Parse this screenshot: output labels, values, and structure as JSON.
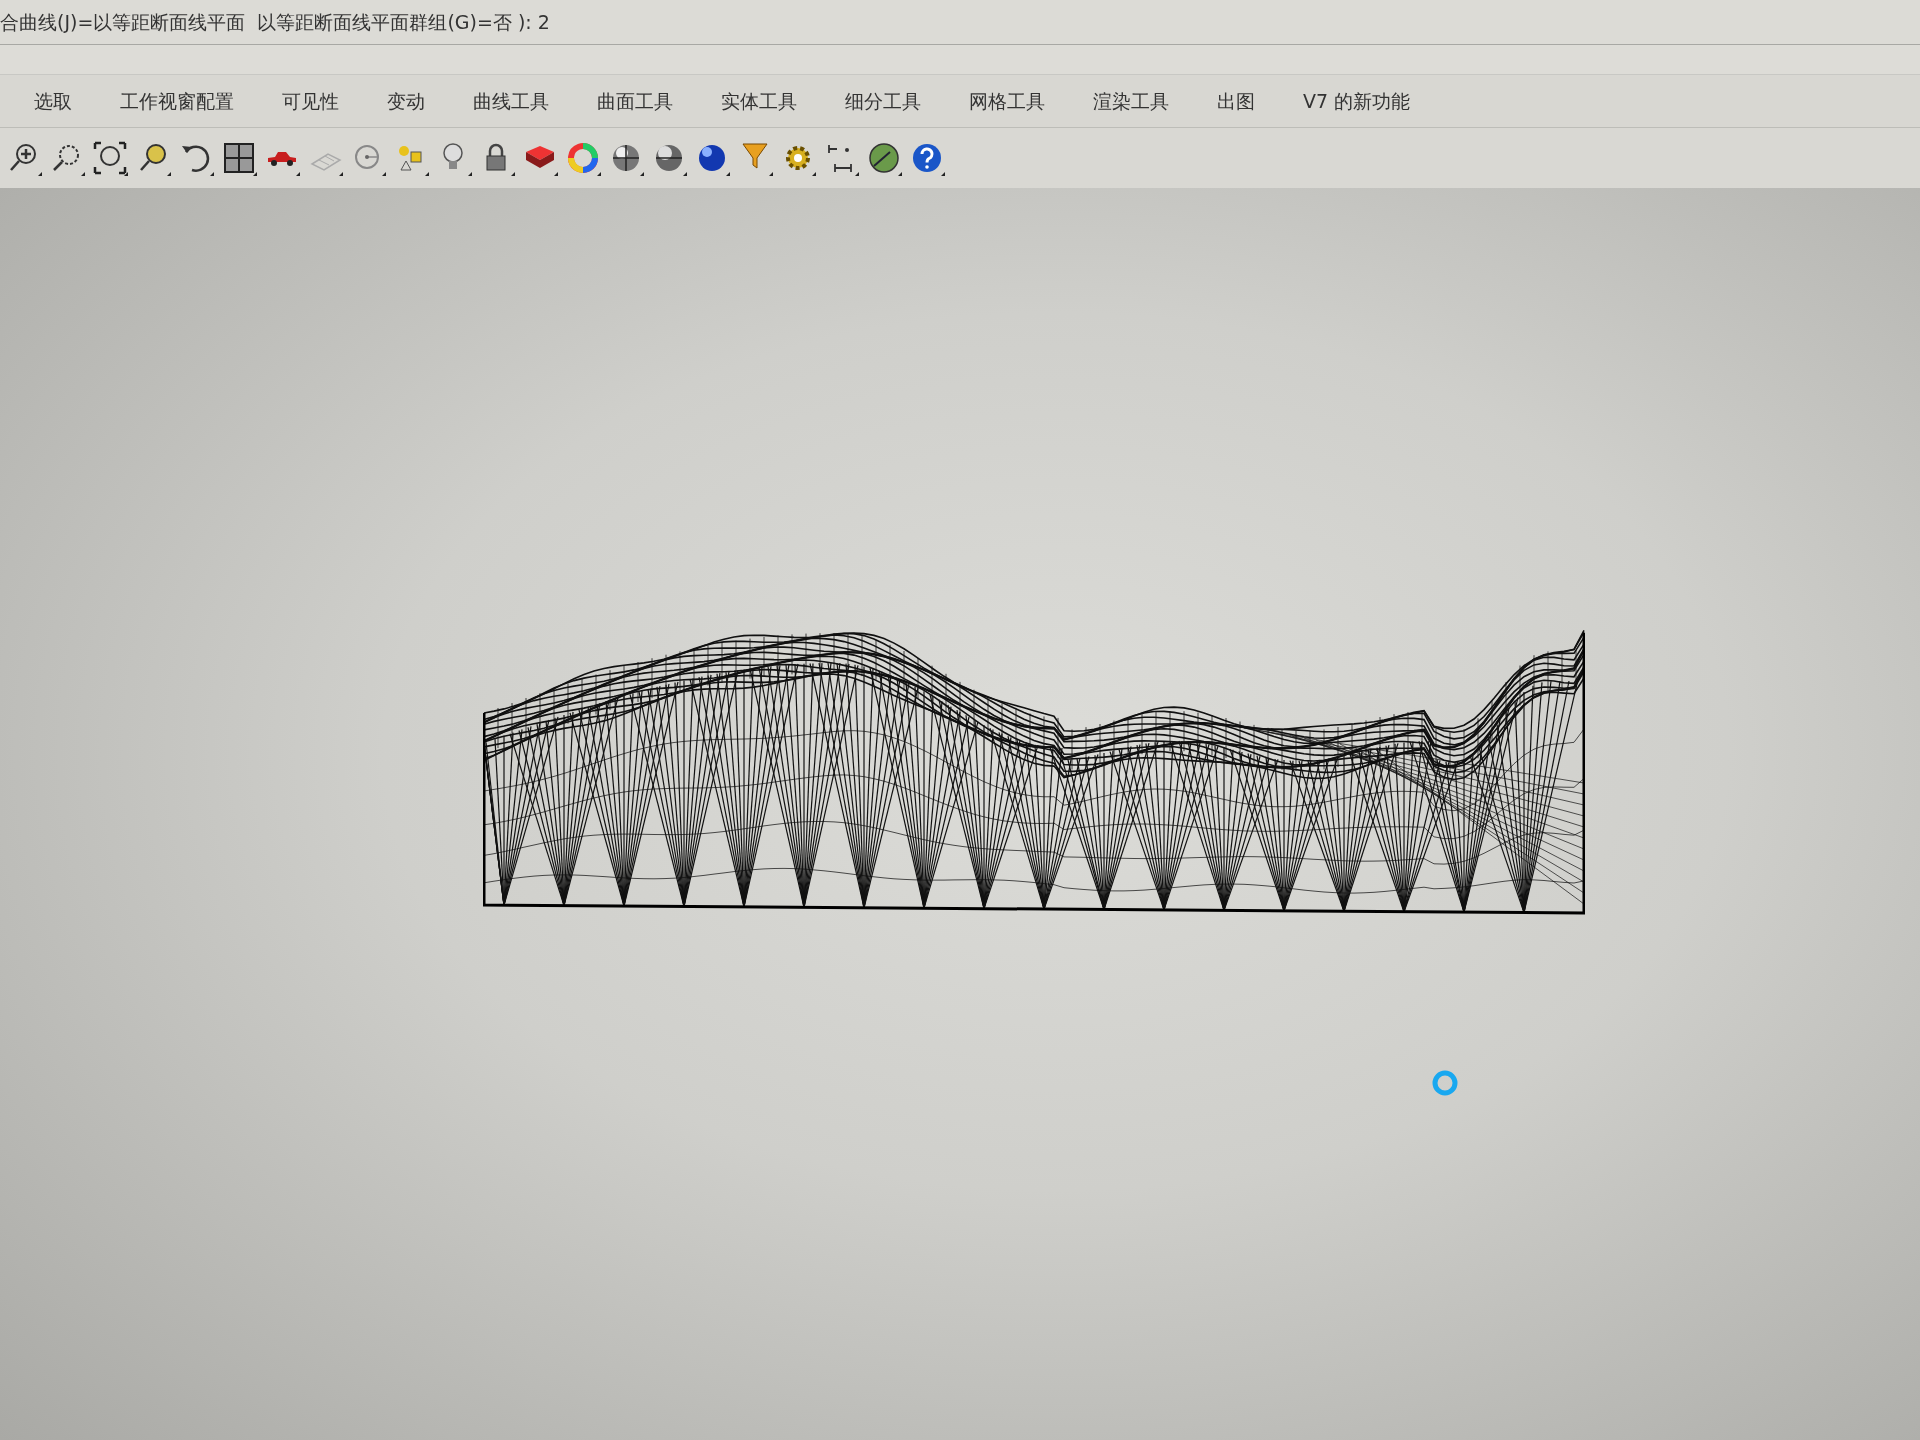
{
  "command_line": {
    "text": "合曲线(J)=以等距断面线平面  以等距断面线平面群组(G)=否 ): 2"
  },
  "tabs": [
    {
      "label": "选取"
    },
    {
      "label": "工作视窗配置"
    },
    {
      "label": "可见性"
    },
    {
      "label": "变动"
    },
    {
      "label": "曲线工具"
    },
    {
      "label": "曲面工具"
    },
    {
      "label": "实体工具"
    },
    {
      "label": "细分工具"
    },
    {
      "label": "网格工具"
    },
    {
      "label": "渲染工具"
    },
    {
      "label": "出图"
    },
    {
      "label": "V7 的新功能"
    }
  ]
}
